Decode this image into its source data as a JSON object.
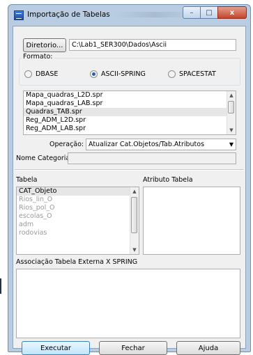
{
  "window": {
    "title": "Importação de Tabelas"
  },
  "titlebar": {
    "minimize": "–",
    "maximize": "□",
    "close": "x"
  },
  "directory": {
    "button_label": "Diretorio...",
    "path": "C:\\Lab1_SER300\\Dados\\Ascii"
  },
  "format": {
    "label": "Formato:",
    "options": [
      "DBASE",
      "ASCII-SPRING",
      "SPACESTAT"
    ],
    "selected": "ASCII-SPRING"
  },
  "files": {
    "items": [
      "Mapa_quadras_L2D.spr",
      "Mapa_quadras_LAB.spr",
      "Quadras_TAB.spr",
      "Reg_ADM_L2D.spr",
      "Reg_ADM_LAB.spr"
    ],
    "selected": "Quadras_TAB.spr"
  },
  "operation": {
    "label": "Operação:",
    "value": "Atualizar Cat.Objetos/Tab.Atributos"
  },
  "category": {
    "label": "Nome Categoria:",
    "value": ""
  },
  "tabela": {
    "label": "Tabela",
    "items": [
      "CAT_Objeto",
      "Rios_lin_O",
      "Rios_pol_O",
      "escolas_O",
      "adm",
      "rodovias"
    ],
    "selected": "CAT_Objeto"
  },
  "atributo": {
    "label": "Atributo Tabela"
  },
  "associacao": {
    "label": "Associação Tabela Externa X SPRING"
  },
  "buttons": {
    "execute": "Executar",
    "close": "Fechar",
    "help": "Ajuda"
  }
}
